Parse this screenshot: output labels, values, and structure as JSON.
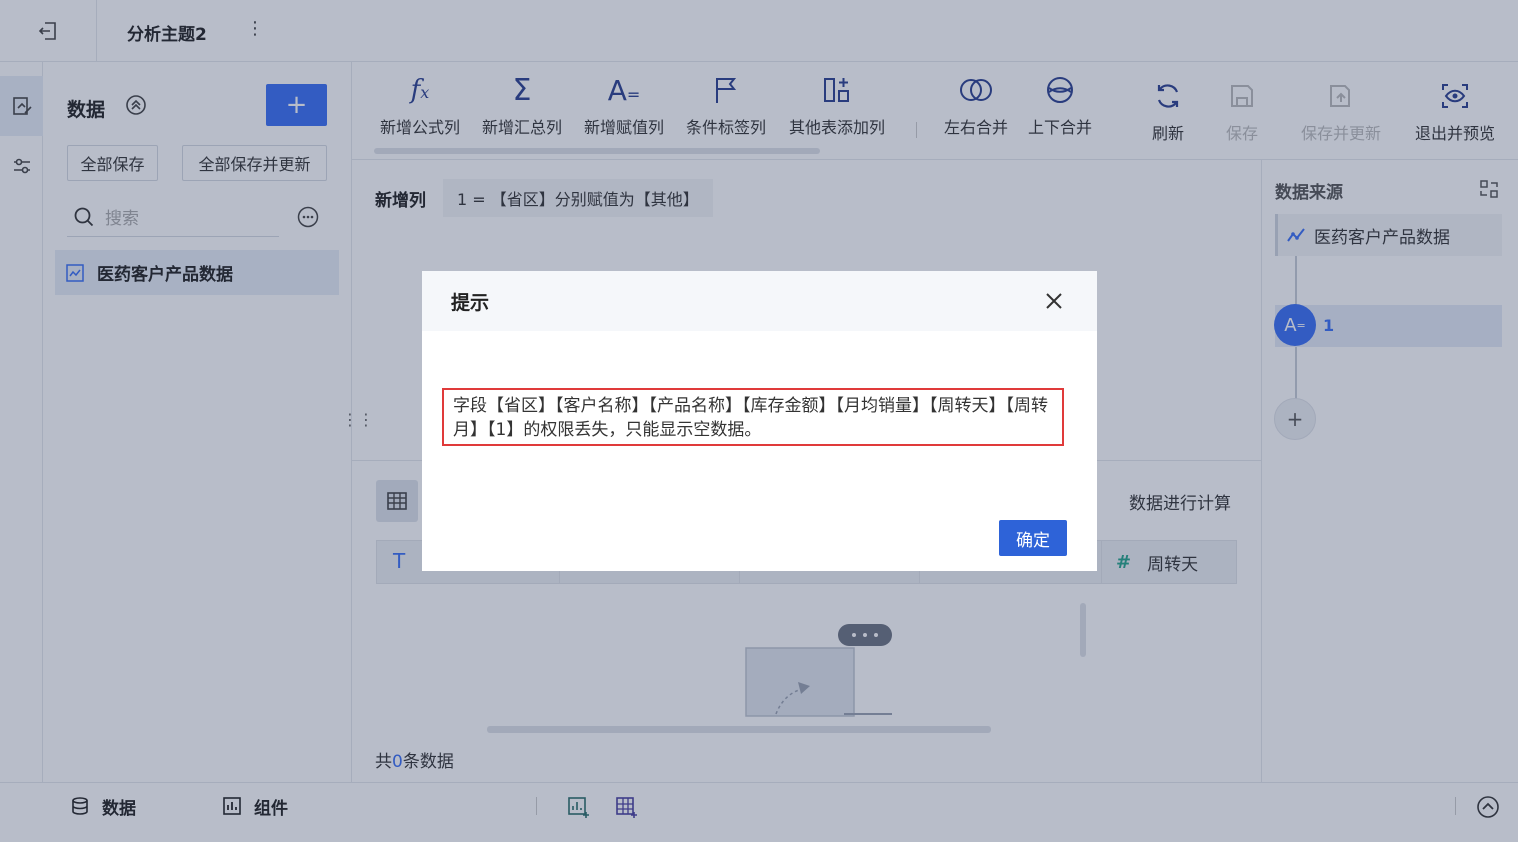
{
  "topbar": {
    "title": "分析主题2",
    "more_label": "⋮"
  },
  "data_panel": {
    "title": "数据",
    "add_label": "+",
    "save_all": "全部保存",
    "save_all_update": "全部保存并更新",
    "search_placeholder": "搜索",
    "dataset_name": "医药客户产品数据"
  },
  "toolbar": {
    "tools": [
      "新增公式列",
      "新增汇总列",
      "新增赋值列",
      "条件标签列",
      "其他表添加列",
      "左右合并",
      "上下合并"
    ]
  },
  "actions": {
    "refresh": "刷新",
    "save": "保存",
    "save_update": "保存并更新",
    "exit_preview": "退出并预览"
  },
  "main": {
    "newcol_label": "新增列",
    "newcol_value": "1 = 【省区】分别赋值为【其他】",
    "calc_text": "数据进行计算",
    "last_column": "周转天",
    "count_prefix": "共",
    "count_value": "0",
    "count_suffix": "条数据"
  },
  "right_panel": {
    "title": "数据来源",
    "source_name": "医药客户产品数据",
    "step_label": "1",
    "add_label": "+"
  },
  "bottombar": {
    "tab_data": "数据",
    "tab_component": "组件"
  },
  "modal": {
    "title": "提示",
    "message": "字段【省区】【客户名称】【产品名称】【库存金额】【月均销量】【周转天】【周转月】【1】的权限丢失，只能显示空数据。",
    "ok_label": "确定"
  },
  "colors": {
    "accent": "#3a6ff5",
    "alert_border": "#e03a3a",
    "ok_button": "#2e63d8"
  }
}
